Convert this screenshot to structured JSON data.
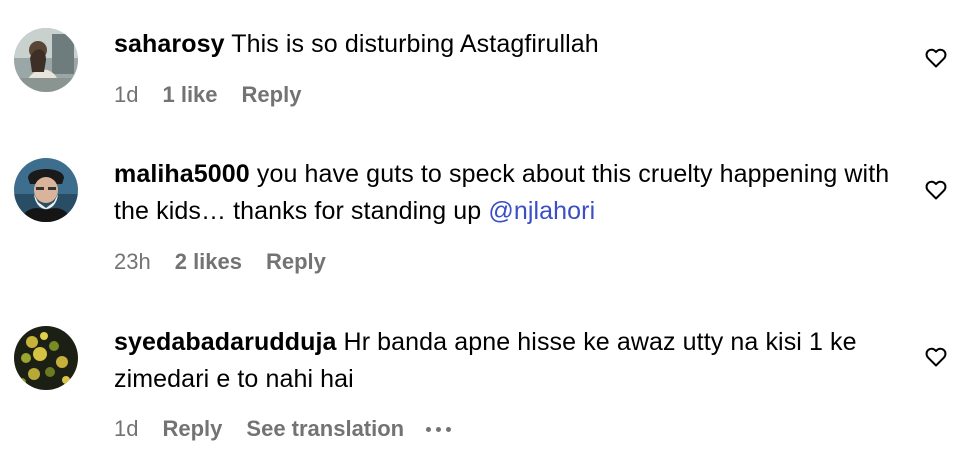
{
  "comments": [
    {
      "username": "saharosy",
      "text": "This is so disturbing Astagfirullah",
      "mention": "",
      "time": "1d",
      "likes": "1 like",
      "reply_label": "Reply",
      "see_translation": "",
      "avatar_icon": "avatar-photo-woman"
    },
    {
      "username": "maliha5000",
      "text": "you have guts to speck about this cruelty happening with the kids… thanks for standing up",
      "mention": "@njlahori",
      "time": "23h",
      "likes": "2 likes",
      "reply_label": "Reply",
      "see_translation": "",
      "avatar_icon": "avatar-photo-man"
    },
    {
      "username": "syedabadarudduja",
      "text": "Hr banda apne hisse ke awaz utty na kisi 1 ke zimedari e to nahi hai",
      "mention": "",
      "time": "1d",
      "likes": "",
      "reply_label": "Reply",
      "see_translation": "See translation",
      "avatar_icon": "avatar-photo-flowers"
    }
  ],
  "icons": {
    "like": "heart-outline-icon",
    "more": "more-horizontal-icon"
  },
  "colors": {
    "text": "#000000",
    "meta": "#737373",
    "mention": "#3b4ec4"
  }
}
